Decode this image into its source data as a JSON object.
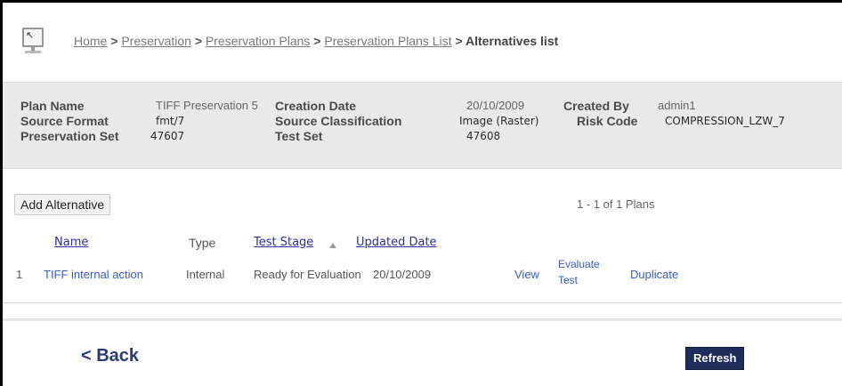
{
  "breadcrumb": {
    "items": [
      "Home",
      "Preservation",
      "Preservation Plans",
      "Preservation Plans List"
    ],
    "current": "Alternatives list",
    "separator": ">"
  },
  "plan": {
    "plan_name_label": "Plan Name",
    "plan_name": "TIFF Preservation 5",
    "source_format_label": "Source Format",
    "source_format": "fmt/7",
    "preservation_set_label": "Preservation Set",
    "preservation_set": "47607",
    "creation_date_label": "Creation Date",
    "creation_date": "20/10/2009",
    "source_classification_label": "Source Classification",
    "source_classification": "Image (Raster)",
    "test_set_label": "Test Set",
    "test_set": "47608",
    "created_by_label": "Created By",
    "created_by": "admin1",
    "risk_code_label": "Risk Code",
    "risk_code": "COMPRESSION_LZW_7"
  },
  "actions": {
    "add_label": "Add Alternative",
    "count": "1 - 1 of 1 Plans"
  },
  "table": {
    "columns": {
      "name": "Name",
      "type": "Type",
      "test_stage": "Test Stage",
      "updated_date": "Updated Date"
    },
    "rows": [
      {
        "index": "1",
        "name": "TIFF internal action",
        "type": "Internal",
        "stage": "Ready for Evaluation",
        "date": "20/10/2009",
        "view": "View",
        "evaluate_1": "Evaluate",
        "evaluate_2": "Test",
        "duplicate": "Duplicate"
      }
    ]
  },
  "footer": {
    "back_label": "< Back",
    "refresh_label": "Refresh"
  },
  "colors": {
    "link": "#3d5bb5",
    "header_link": "#2c2f9a",
    "panel_bg": "#e9e9e9",
    "refresh_bg": "#1e2d5a"
  },
  "icons": {
    "header": "monitor-icon",
    "sort": "sort-ascending-icon"
  }
}
